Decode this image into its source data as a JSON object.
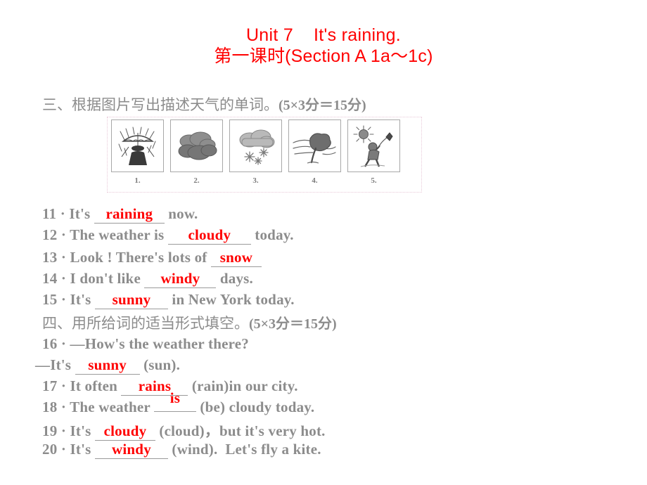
{
  "title": {
    "line1": "Unit 7    It's raining.",
    "line2": "第一课时(Section A 1a～1c)"
  },
  "sections": [
    {
      "id": "section-three",
      "heading": "三、根据图片写出描述天气的单词。",
      "score": "(5×3分＝15分)"
    },
    {
      "id": "section-four",
      "heading": "四、用所给词的适当形式填空。",
      "score": "(5×3分＝15分)"
    }
  ],
  "pictures": [
    {
      "label": "1.",
      "icon": "rain-person-umbrella-icon",
      "alt": "person with umbrella in rain"
    },
    {
      "label": "2.",
      "icon": "clouds-icon",
      "alt": "cloudy"
    },
    {
      "label": "3.",
      "icon": "cloud-snowflakes-icon",
      "alt": "snowing"
    },
    {
      "label": "4.",
      "icon": "windy-tree-icon",
      "alt": "tree bending in wind"
    },
    {
      "label": "5.",
      "icon": "sun-kite-child-icon",
      "alt": "sunny, child flying a kite"
    }
  ],
  "questions": [
    {
      "number": "11",
      "sep": "·",
      "before": "It's ",
      "answer": "raining",
      "after": " now."
    },
    {
      "number": "12",
      "sep": "·",
      "before": "The weather is ",
      "answer": "cloudy",
      "after": " today."
    },
    {
      "number": "13",
      "sep": "·",
      "before": "Look ! There's lots of ",
      "answer": "snow",
      "after": ""
    },
    {
      "number": "14",
      "sep": "·",
      "before": "I don't like ",
      "answer": "windy",
      "after": " days."
    },
    {
      "number": "15",
      "sep": "·",
      "before": "It's ",
      "answer": "sunny",
      "after": " in New York today."
    },
    {
      "number": "16",
      "sep": "·",
      "before": "—How's the weather there?",
      "answer": "",
      "after": ""
    },
    {
      "number": "",
      "sep": "",
      "before": "—It's ",
      "answer": "sunny",
      "after": " (sun)."
    },
    {
      "number": "17",
      "sep": "·",
      "before": "It often ",
      "answer": "rains",
      "after": " (rain)in our city."
    },
    {
      "number": "18",
      "sep": "·",
      "before": "The weather ",
      "answer": "is",
      "after": " (be) cloudy today."
    },
    {
      "number": "19",
      "sep": "·",
      "before": "It's ",
      "answer": "cloudy",
      "after": " (cloud)，but it's very hot."
    },
    {
      "number": "20",
      "sep": "·",
      "before": "It's ",
      "answer": "windy",
      "after": " (wind).  Let's fly a kite."
    }
  ],
  "colors": {
    "answer_red": "#ff0000",
    "body_gray": "#8c8c8c",
    "rule_gray": "#9a9a9a"
  }
}
